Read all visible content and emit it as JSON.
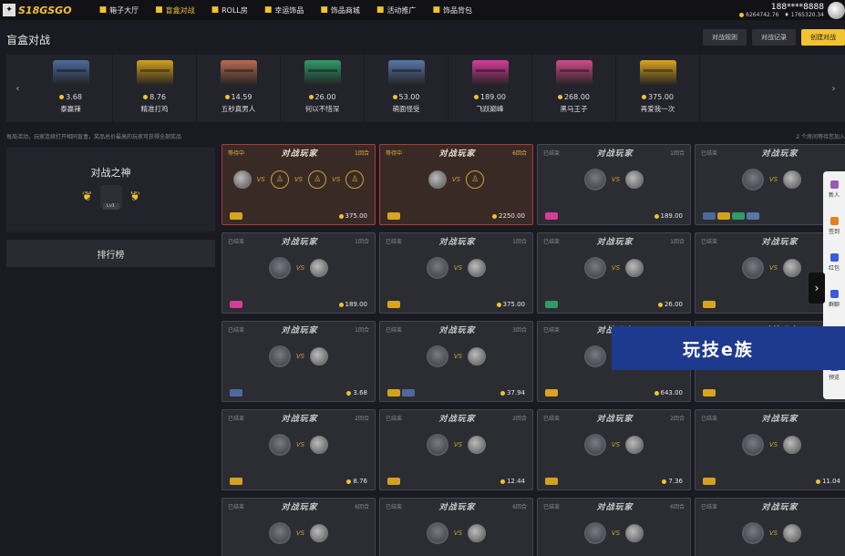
{
  "app": {
    "logo_text": "S18GSGO"
  },
  "nav": [
    {
      "label": "箱子大厅",
      "icon": "paper-plane-icon",
      "active": false
    },
    {
      "label": "盲盒对战",
      "icon": "swords-icon",
      "active": true
    },
    {
      "label": "ROLL房",
      "icon": "house-icon",
      "active": false
    },
    {
      "label": "幸运饰品",
      "icon": "lucky-icon",
      "active": false
    },
    {
      "label": "饰品商城",
      "icon": "shop-icon",
      "active": false
    },
    {
      "label": "活动推广",
      "icon": "promo-icon",
      "active": false
    },
    {
      "label": "饰品背包",
      "icon": "backpack-icon",
      "active": false
    }
  ],
  "user": {
    "name": "188****8888",
    "gold": "6264742.76",
    "diamond": "1765320.34"
  },
  "page": {
    "title": "盲盒对战"
  },
  "buttons": {
    "rules": "对战规则",
    "records": "对战记录",
    "create": "创建对战"
  },
  "cases": [
    {
      "name": "泰赢辣",
      "price": "3.68",
      "color": "#4d6a9c"
    },
    {
      "name": "精准打鸡",
      "price": "8.76",
      "color": "#d4a11e"
    },
    {
      "name": "五秒真男人",
      "price": "14.59",
      "color": "#b86c50"
    },
    {
      "name": "何以不惜深",
      "price": "26.00",
      "color": "#2f9a6a"
    },
    {
      "name": "萌面怪受",
      "price": "53.00",
      "color": "#5876a8"
    },
    {
      "name": "飞跃巅峰",
      "price": "189.00",
      "color": "#d63c9a"
    },
    {
      "name": "黑马王子",
      "price": "268.00",
      "color": "#d04c8c"
    },
    {
      "name": "再爱我一次",
      "price": "375.00",
      "color": "#d9a420"
    }
  ],
  "info": {
    "left": "每局活动，玩家连续打开相同盲盒，奖品总价最高的玩家可获得全部奖品",
    "right": "2 个房间等待您加入"
  },
  "god": {
    "title": "对战之神",
    "level": "Lv1"
  },
  "ranking": {
    "label": "排行榜"
  },
  "card_title": "对战玩家",
  "cards": [
    {
      "status": "等待中",
      "rounds": "1回合",
      "price": "375.00",
      "waiting": true,
      "players": 4,
      "boxes": [
        "#d9a420"
      ]
    },
    {
      "status": "等待中",
      "rounds": "6回合",
      "price": "2250.00",
      "waiting": true,
      "players": 2,
      "boxes": [
        "#d9a420"
      ]
    },
    {
      "status": "已结束",
      "rounds": "1回合",
      "price": "189.00",
      "waiting": false,
      "players": 2,
      "boxes": [
        "#d63c9a"
      ]
    },
    {
      "status": "已结束",
      "rounds": "",
      "price": "",
      "waiting": false,
      "players": 2,
      "boxes": [
        "#4d6a9c",
        "#d4a11e",
        "#2f9a6a",
        "#5876a8"
      ]
    },
    {
      "status": "已结束",
      "rounds": "1回合",
      "price": "189.00",
      "waiting": false,
      "players": 2,
      "boxes": [
        "#d63c9a"
      ]
    },
    {
      "status": "已结束",
      "rounds": "1回合",
      "price": "375.00",
      "waiting": false,
      "players": 2,
      "boxes": [
        "#d9a420"
      ]
    },
    {
      "status": "已结束",
      "rounds": "1回合",
      "price": "26.00",
      "waiting": false,
      "players": 2,
      "boxes": [
        "#2f9a6a"
      ]
    },
    {
      "status": "已结束",
      "rounds": "",
      "price": "",
      "waiting": false,
      "players": 2,
      "boxes": [
        "#d9a420"
      ]
    },
    {
      "status": "已结束",
      "rounds": "1回合",
      "price": "3.68",
      "waiting": false,
      "players": 2,
      "boxes": [
        "#4d6a9c"
      ]
    },
    {
      "status": "已结束",
      "rounds": "3回合",
      "price": "37.94",
      "waiting": false,
      "players": 2,
      "boxes": [
        "#d4a11e",
        "#4d6a9c"
      ]
    },
    {
      "status": "已结束",
      "rounds": "3回合",
      "price": "643.00",
      "waiting": false,
      "players": 2,
      "boxes": [
        "#d9a420"
      ]
    },
    {
      "status": "已结束",
      "rounds": "",
      "price": "",
      "waiting": false,
      "players": 2,
      "boxes": [
        "#d9a420"
      ]
    },
    {
      "status": "已结束",
      "rounds": "2回合",
      "price": "8.76",
      "waiting": false,
      "players": 2,
      "boxes": [
        "#d4a11e"
      ]
    },
    {
      "status": "已结束",
      "rounds": "2回合",
      "price": "12.44",
      "waiting": false,
      "players": 2,
      "boxes": [
        "#d4a11e"
      ]
    },
    {
      "status": "已结束",
      "rounds": "2回合",
      "price": "7.36",
      "waiting": false,
      "players": 2,
      "boxes": [
        "#d4a11e"
      ]
    },
    {
      "status": "已结束",
      "rounds": "",
      "price": "11.04",
      "waiting": false,
      "players": 2,
      "boxes": [
        "#d4a11e"
      ]
    },
    {
      "status": "已结束",
      "rounds": "6回合",
      "price": "",
      "waiting": false,
      "players": 2,
      "boxes": []
    },
    {
      "status": "已结束",
      "rounds": "6回合",
      "price": "",
      "waiting": false,
      "players": 2,
      "boxes": []
    },
    {
      "status": "已结束",
      "rounds": "6回合",
      "price": "",
      "waiting": false,
      "players": 2,
      "boxes": []
    },
    {
      "status": "已结束",
      "rounds": "",
      "price": "",
      "waiting": false,
      "players": 2,
      "boxes": []
    }
  ],
  "side_panel": [
    {
      "label": "新人",
      "color": "#9b59b6"
    },
    {
      "label": "签到",
      "color": "#e67e22"
    },
    {
      "label": "红包",
      "color": "#3b5bdb"
    },
    {
      "label": "群聊",
      "color": "#3b5bdb"
    },
    {
      "label": "R",
      "color": "#3b5bdb"
    },
    {
      "label": "预览",
      "color": "#3b5bdb"
    }
  ],
  "watermark": {
    "text": "玩技e族"
  }
}
